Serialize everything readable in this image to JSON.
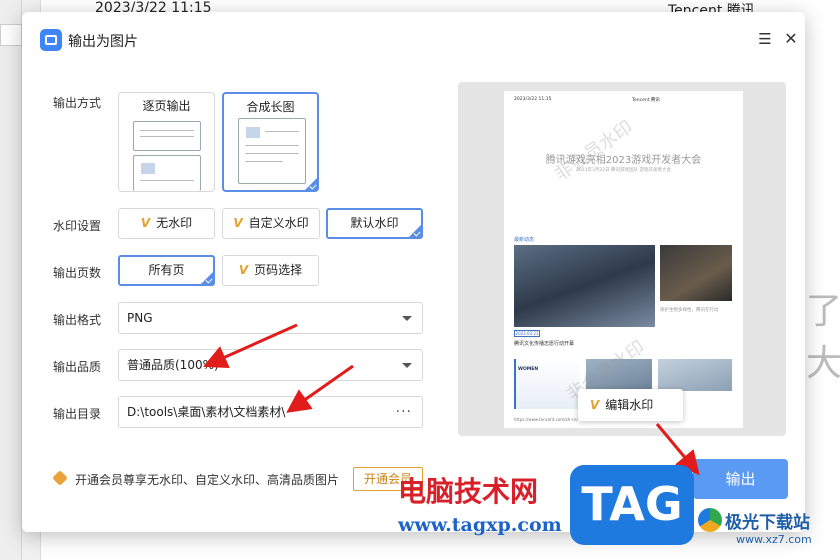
{
  "background": {
    "top_left": "2023/3/22 11:15",
    "top_right": "Tencent 腾讯",
    "side_glyph": "了大"
  },
  "dialog": {
    "title": "输出为图片",
    "menu_icon": "hamburger-menu-icon",
    "close_icon": "close-icon"
  },
  "form": {
    "output_mode": {
      "label": "输出方式",
      "options": [
        "逐页输出",
        "合成长图"
      ],
      "selected": "合成长图"
    },
    "watermark": {
      "label": "水印设置",
      "options": [
        "无水印",
        "自定义水印",
        "默认水印"
      ],
      "selected": "默认水印"
    },
    "pages": {
      "label": "输出页数",
      "options": [
        "所有页",
        "页码选择"
      ],
      "selected": "所有页"
    },
    "format": {
      "label": "输出格式",
      "value": "PNG"
    },
    "quality": {
      "label": "输出品质",
      "value": "普通品质(100%)"
    },
    "directory": {
      "label": "输出目录",
      "value": "D:\\tools\\桌面\\素材\\文档素材\\",
      "more": "···"
    }
  },
  "promo": {
    "text": "开通会员尊享无水印、自定义水印、高清品质图片",
    "button": "开通会员"
  },
  "preview": {
    "page_date": "2023/3/22 11:15",
    "page_brand": "Tencent 腾讯",
    "headline": "腾讯游戏亮相2023游戏开发者大会",
    "subline": "2023年3月22日 腾讯游戏团队 游戏开发者大会",
    "section": "最新动态",
    "image_caption": "保护生物多样性，腾讯在行动",
    "tag": "2023.03.21",
    "headline2": "腾讯文化传播志愿行动开幕",
    "women": "WOMEN",
    "footer": "https://www.tencent.com/zh-cn/",
    "watermark_text": "非会员水印",
    "edit_button": "编辑水印"
  },
  "export_button": "输出",
  "overlay": {
    "site_name": "电脑技术网",
    "site_url": "www.tagxp.com",
    "badge": "TAG",
    "xz_name": "极光下载站",
    "xz_url": "www.xz7.com"
  }
}
